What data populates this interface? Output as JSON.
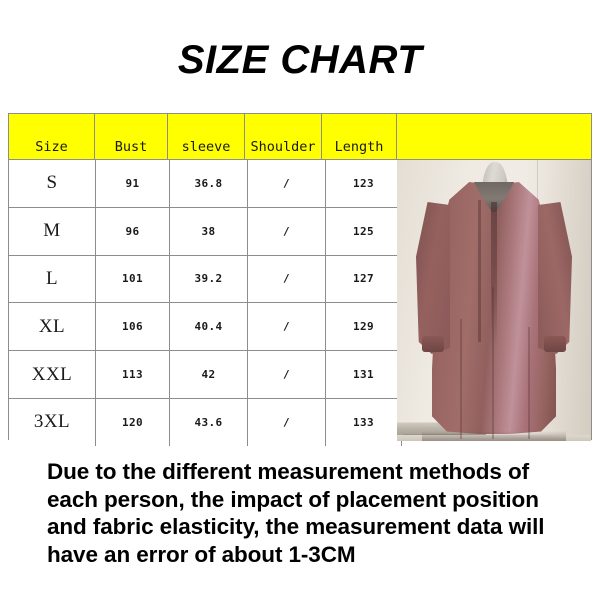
{
  "title": "SIZE CHART",
  "table": {
    "headers": [
      "Size",
      "Bust",
      "sleeve",
      "Shoulder",
      "Length"
    ],
    "rows": [
      {
        "size": "S",
        "bust": "91",
        "sleeve": "36.8",
        "shoulder": "/",
        "length": "123"
      },
      {
        "size": "M",
        "bust": "96",
        "sleeve": "38",
        "shoulder": "/",
        "length": "125"
      },
      {
        "size": "L",
        "bust": "101",
        "sleeve": "39.2",
        "shoulder": "/",
        "length": "127"
      },
      {
        "size": "XL",
        "bust": "106",
        "sleeve": "40.4",
        "shoulder": "/",
        "length": "129"
      },
      {
        "size": "XXL",
        "bust": "113",
        "sleeve": "42",
        "shoulder": "/",
        "length": "131"
      },
      {
        "size": "3XL",
        "bust": "120",
        "sleeve": "43.6",
        "shoulder": "/",
        "length": "133"
      }
    ]
  },
  "product_photo": {
    "description": "Mauve long-sleeve V-neck dress displayed on a mannequin against a beige wall",
    "garment_color": "#95615f",
    "highlight_color": "#c0919a",
    "wall_color": "#ece8e1"
  },
  "disclaimer": "Due to the different measurement methods of each person, the impact of placement position and fabric elasticity, the measurement data will have an error of about 1-3CM",
  "colors": {
    "header_background": "#ffff00",
    "border": "#8d8d8d",
    "text": "#000000",
    "page_background": "#ffffff"
  }
}
